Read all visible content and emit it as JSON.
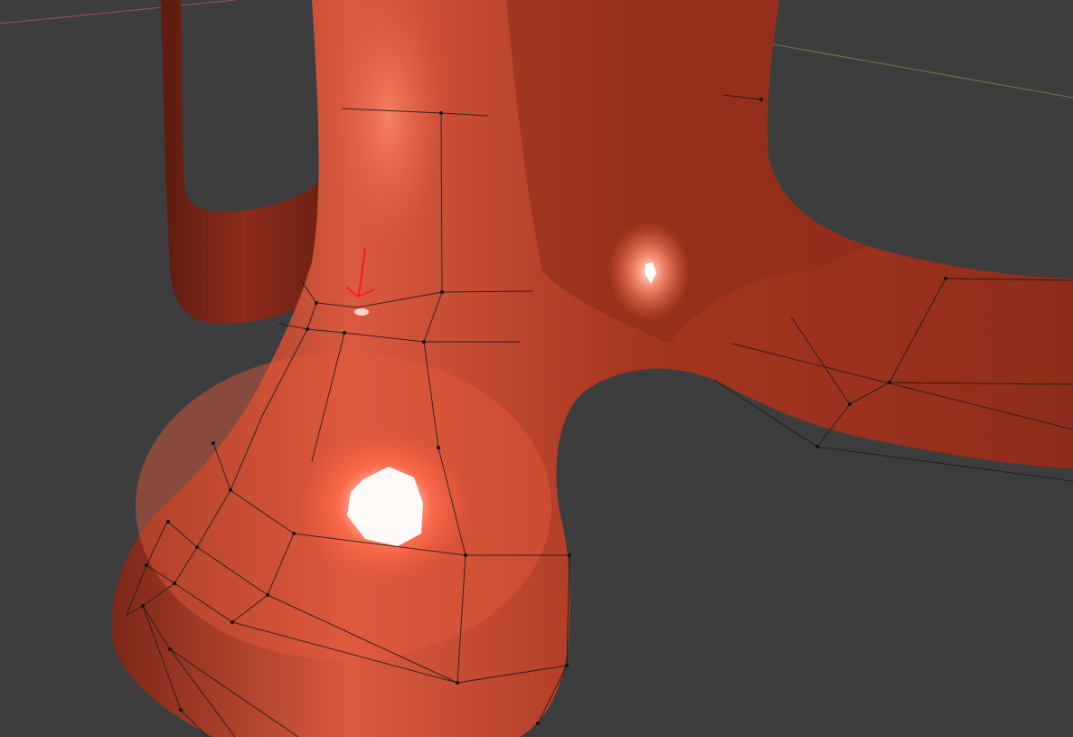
{
  "viewport": {
    "background": "#3d3d3d",
    "mesh_color": "#b53a22",
    "mesh_highlight": "#ff8a6a",
    "wire_color": "#1a1a1a",
    "axis_x_color": "#a24f62",
    "axis_y_color": "#6e7a44",
    "annotation_color": "#ff1a1a",
    "annotation_icon": "hand-drawn-red-arrow"
  }
}
